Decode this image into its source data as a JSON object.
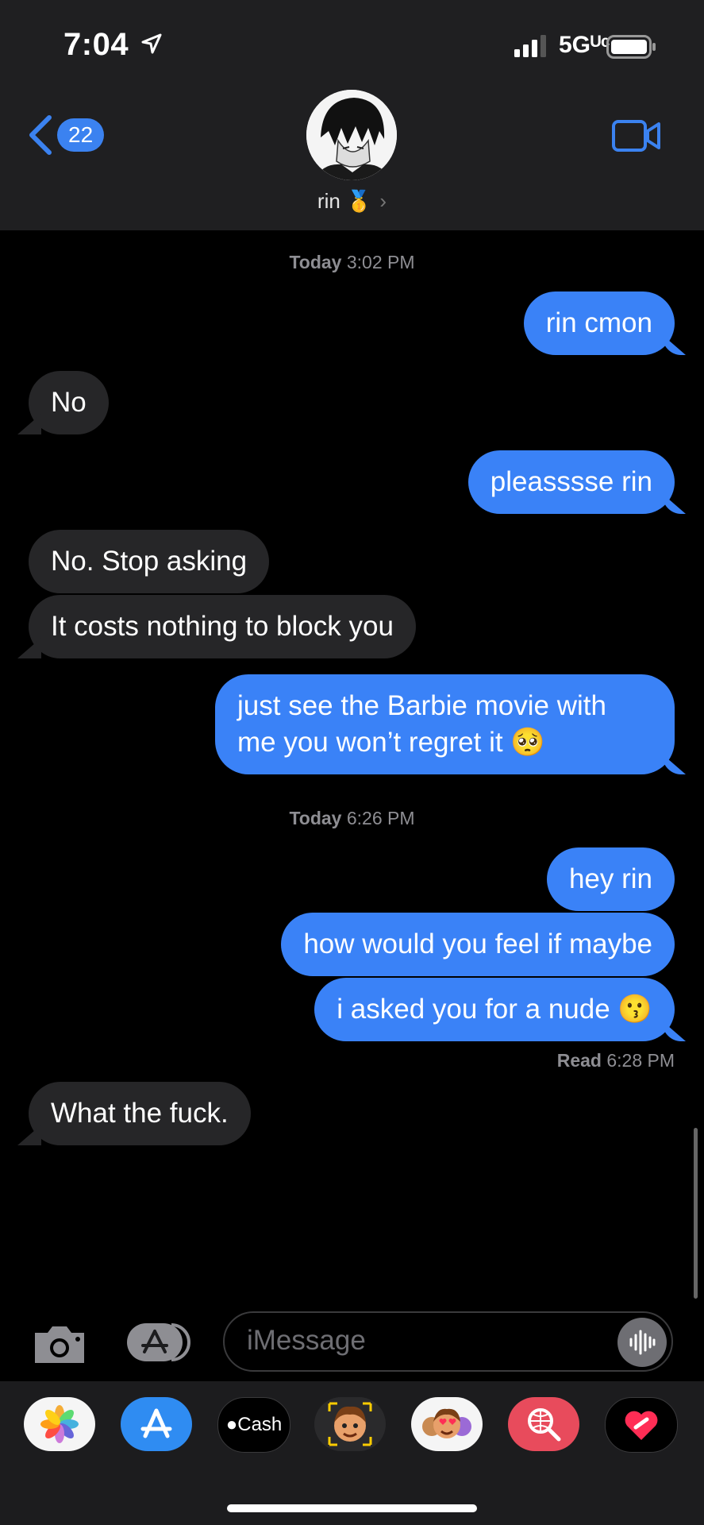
{
  "status_bar": {
    "time": "7:04",
    "network": "5Gᵁᶜ"
  },
  "header": {
    "back_count": "22",
    "contact_name": "rin 🥇",
    "chevron": "›"
  },
  "thread": [
    {
      "type": "timestamp",
      "day": "Today",
      "time": "3:02 PM"
    },
    {
      "type": "outgoing",
      "text": "rin cmon"
    },
    {
      "type": "incoming",
      "text": "No"
    },
    {
      "type": "outgoing",
      "text": "pleasssse rin"
    },
    {
      "type": "incoming",
      "text": "No. Stop asking"
    },
    {
      "type": "incoming",
      "text": "It costs nothing to block you"
    },
    {
      "type": "outgoing",
      "text": "just see the Barbie movie with me you won’t regret it 🥺"
    },
    {
      "type": "timestamp",
      "day": "Today",
      "time": "6:26 PM"
    },
    {
      "type": "outgoing",
      "text": "hey rin"
    },
    {
      "type": "outgoing",
      "text": "how would you feel if maybe"
    },
    {
      "type": "outgoing",
      "text": "i asked you for a nude 😗"
    },
    {
      "type": "receipt",
      "label": "Read",
      "time": "6:28 PM"
    },
    {
      "type": "incoming",
      "text": "What the fuck."
    }
  ],
  "compose": {
    "placeholder": "iMessage"
  },
  "app_drawer": [
    {
      "name": "photos-icon"
    },
    {
      "name": "app-store-icon"
    },
    {
      "name": "apple-cash-icon",
      "label": "Cash"
    },
    {
      "name": "memoji-icon"
    },
    {
      "name": "memoji-stickers-icon"
    },
    {
      "name": "web-search-icon"
    },
    {
      "name": "digital-touch-icon"
    }
  ],
  "colors": {
    "outgoing": "#3a82f7",
    "incoming": "#262628",
    "background": "#000000"
  }
}
